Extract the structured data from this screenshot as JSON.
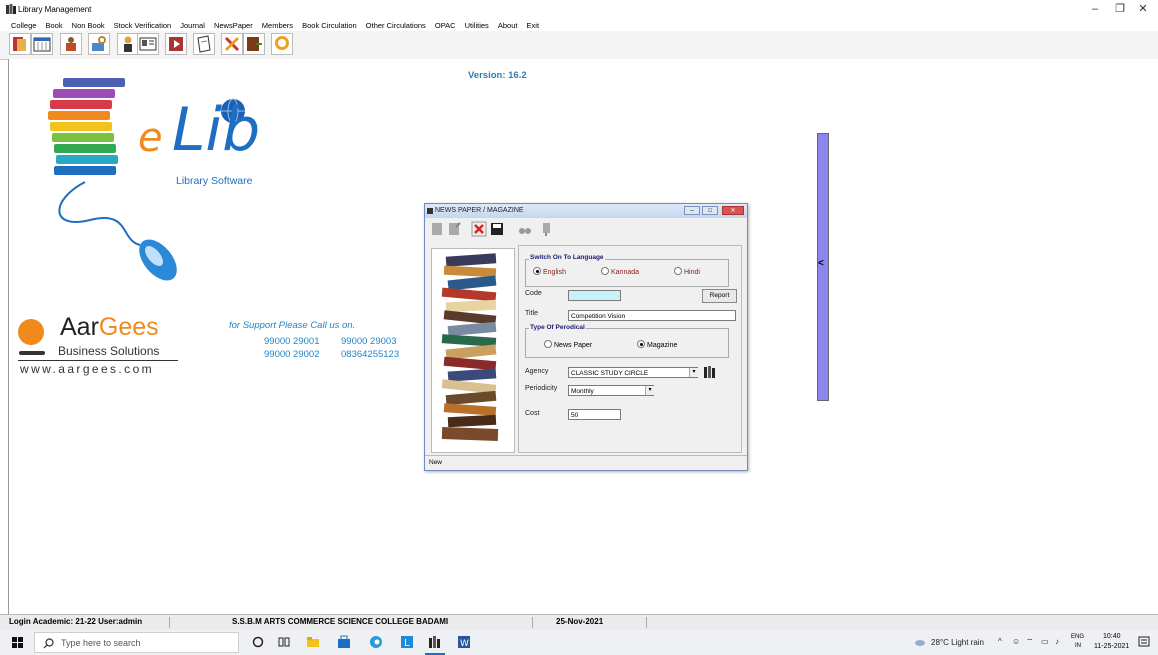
{
  "window": {
    "title": "Library Management",
    "controls": {
      "minimize": "–",
      "restore": "❐",
      "close": "✕"
    }
  },
  "menu": [
    "College",
    "Book",
    "Non Book",
    "Stock Verification",
    "Journal",
    "NewsPaper",
    "Members",
    "Book Circulation",
    "Other Circulations",
    "OPAC",
    "Utilities",
    "About",
    "Exit"
  ],
  "toolbar": {
    "icons": [
      "book-add-icon",
      "calendar-icon",
      "reader-icon",
      "key-icon",
      "member-icon",
      "card-icon",
      "film-icon",
      "journal-icon",
      "tools-icon",
      "exit-book-icon",
      "chat-icon"
    ]
  },
  "main": {
    "version": "Version: 16.2",
    "logo": {
      "e": "e",
      "lib": "Lib",
      "subtitle": "Library Software"
    },
    "company": {
      "name_a": "Aar",
      "name_b": "Gees",
      "tagline": "Business Solutions",
      "website": "www.aargees.com",
      "support": "for Support Please Call us on.",
      "phones": [
        "99000 29001",
        "99000 29003",
        "99000 29002",
        "08364255123"
      ]
    }
  },
  "dialog": {
    "title": "NEWS PAPER / MAGAZINE",
    "language": {
      "group_label": "Switch On To Language",
      "options": [
        "English",
        "Kannada",
        "Hindi"
      ],
      "selected": "English"
    },
    "code": {
      "label": "Code",
      "value": ""
    },
    "report_button": "Report",
    "title_field": {
      "label": "Title",
      "value": "Competition Vision"
    },
    "type": {
      "group_label": "Type Of Perodical",
      "options": [
        "News Paper",
        "Magazine"
      ],
      "selected": "Magazine"
    },
    "agency": {
      "label": "Agency",
      "value": "CLASSIC STUDY CIRCLE"
    },
    "periodicity": {
      "label": "Periodicity",
      "value": "Monthly"
    },
    "cost": {
      "label": "Cost",
      "value": "50"
    },
    "status": "New"
  },
  "statusbar": {
    "login": "Login Academic: 21-22 User:admin",
    "college": "S.S.B.M ARTS COMMERCE SCIENCE COLLEGE BADAMI",
    "date": "25-Nov-2021"
  },
  "taskbar": {
    "search_placeholder": "Type here to search",
    "weather": "28°C  Light rain",
    "lang_top": "ENG",
    "lang_bottom": "IN",
    "time": "10:40",
    "date": "11-25-2021"
  },
  "colors": {
    "version_blue": "#2a7fb5",
    "logo_orange": "#f08a1c",
    "logo_blue": "#1e6fc1",
    "scroll_purple": "#8b87ee"
  }
}
